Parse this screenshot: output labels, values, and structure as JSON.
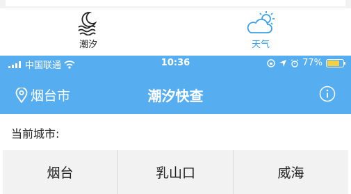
{
  "tabbar": {
    "items": [
      {
        "label": "潮汐",
        "icon": "moon-waves-icon",
        "active": false
      },
      {
        "label": "天气",
        "icon": "sun-cloud-icon",
        "active": true
      }
    ],
    "active_color": "#3aa0e8"
  },
  "statusbar": {
    "carrier": "中国联通",
    "time": "10:36",
    "battery": "77%",
    "battery_level": 0.77
  },
  "navbar": {
    "location": "烟台市",
    "title": "潮汐快查",
    "background": "#56aef0"
  },
  "content": {
    "city_label": "当前城市:",
    "cities": [
      "烟台",
      "乳山口",
      "威海"
    ]
  }
}
